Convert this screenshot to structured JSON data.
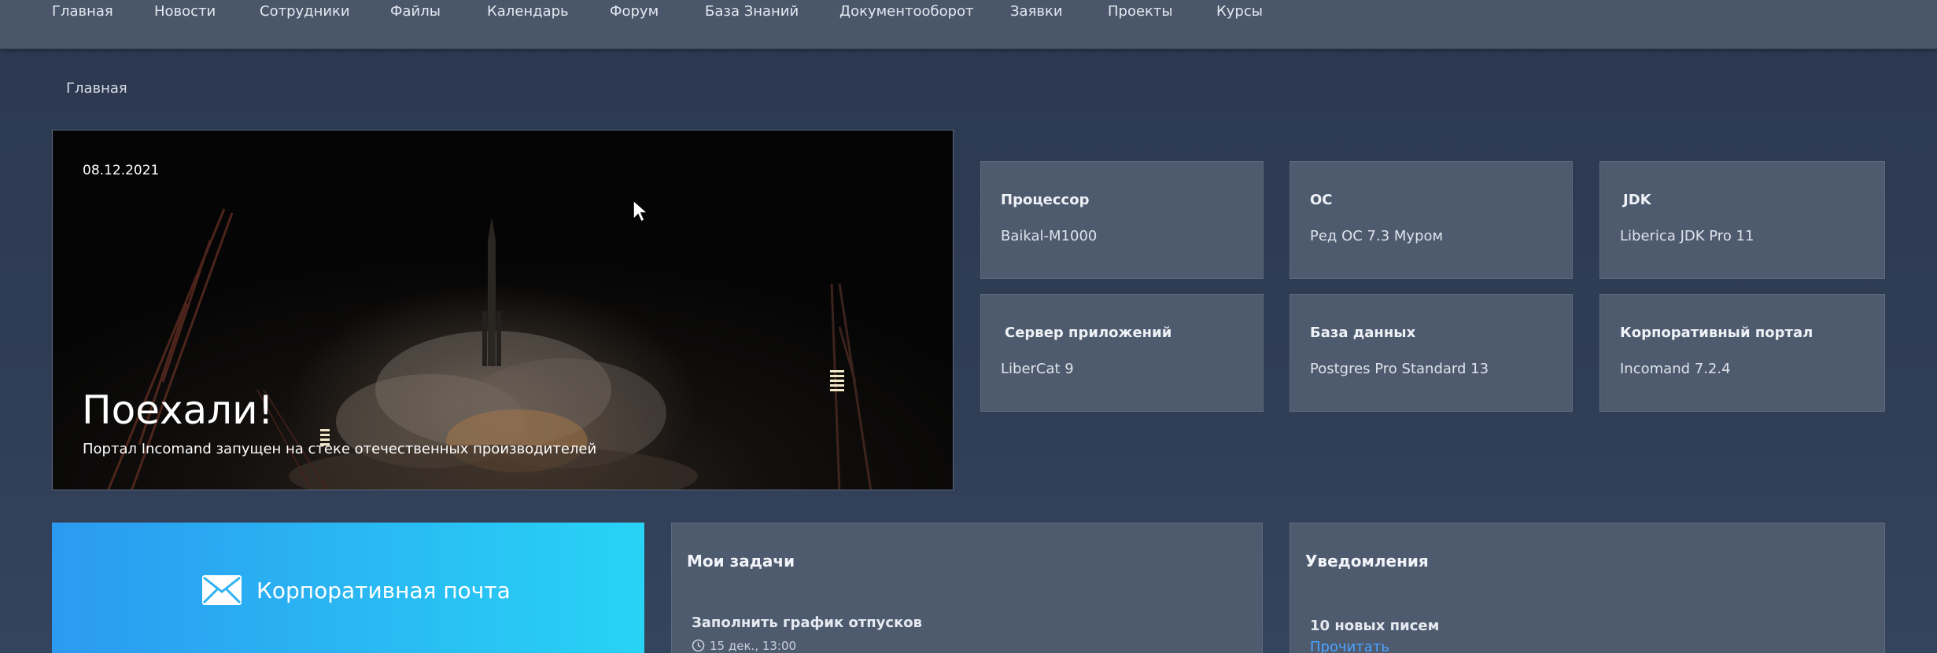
{
  "nav": {
    "items": [
      {
        "label": "Главная"
      },
      {
        "label": "Новости"
      },
      {
        "label": "Сотрудники"
      },
      {
        "label": "Файлы"
      },
      {
        "label": "Календарь"
      },
      {
        "label": "Форум"
      },
      {
        "label": "База Знаний"
      },
      {
        "label": "Документооборот"
      },
      {
        "label": "Заявки"
      },
      {
        "label": "Проекты"
      },
      {
        "label": "Курсы"
      }
    ]
  },
  "breadcrumb": {
    "current": "Главная"
  },
  "hero": {
    "date": "08.12.2021",
    "title": "Поехали!",
    "subtitle": "Портал Incomand запущен на стеке отечественных производителей"
  },
  "specs": [
    {
      "label": "Процессор",
      "value": "Baikal-M1000"
    },
    {
      "label": "ОС",
      "value": "Ред ОС 7.3 Муром"
    },
    {
      "label": "JDK",
      "value": "Liberica JDK Pro 11"
    },
    {
      "label": "Сервер приложений",
      "value": "LiberCat 9"
    },
    {
      "label": "База данных",
      "value": "Postgres Pro Standard 13"
    },
    {
      "label": "Корпоративный портал",
      "value": "Incomand 7.2.4"
    }
  ],
  "mail": {
    "label": "Корпоративная почта",
    "icon": "envelope-icon"
  },
  "tasks": {
    "title": "Мои задачи",
    "items": [
      {
        "title": "Заполнить график отпусков",
        "due": "15 дек., 13:00"
      }
    ]
  },
  "notifications": {
    "title": "Уведомления",
    "items": [
      {
        "text": "10 новых писем",
        "link": "Прочитать"
      }
    ]
  },
  "colors": {
    "background": "#2f3d55",
    "nav": "#4a576b",
    "card": "#4e5b6f",
    "mail_gradient_start": "#2b9af0",
    "mail_gradient_end": "#28d3f5",
    "link": "#4aa3ff"
  }
}
